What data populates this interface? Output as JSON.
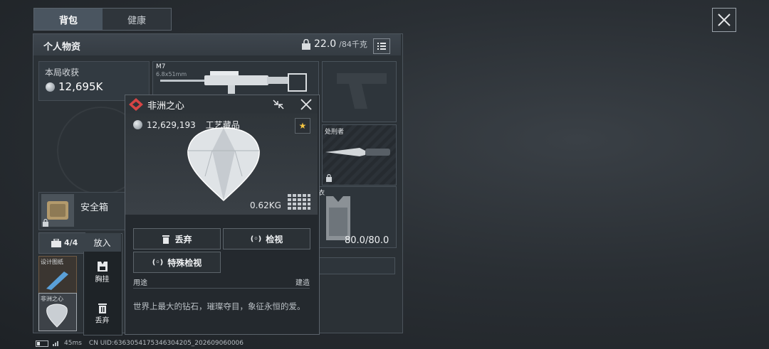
{
  "tabs": [
    {
      "label": "背包",
      "active": true
    },
    {
      "label": "健康",
      "active": false
    }
  ],
  "panel": {
    "title": "个人物资",
    "weight_current": "22.0",
    "weight_capacity": "/84千克"
  },
  "harvest": {
    "label": "本局收获",
    "value": "12,695K"
  },
  "equipment": {
    "weapon_name": "M7",
    "weapon_caliber": "6.8x51mm",
    "knife_name": "处刑者",
    "armor_label": "衣",
    "armor_durability": "80.0/80.0"
  },
  "safebox": {
    "label": "安全箱"
  },
  "backpack": {
    "capacity": "4/4",
    "item1_label": "设计图纸",
    "item2_label": "非洲之心"
  },
  "context_menu": {
    "place": "放入",
    "chest": "胸挂",
    "discard": "丢弃"
  },
  "popup": {
    "title": "非洲之心",
    "price": "12,629,193",
    "category": "工艺藏品",
    "weight": "0.62KG",
    "btn_discard": "丢弃",
    "btn_inspect": "检视",
    "btn_special": "特殊检视",
    "use_label": "用途",
    "build_label": "建造",
    "description": "世界上最大的钻石，璀璨夺目，象征永恒的爱。"
  },
  "footer": {
    "ping": "45ms",
    "uid": "CN UID:6363054175346304205_202609060006"
  },
  "colors": {
    "accent_star": "#f5c542",
    "rarity_red": "#d64545"
  }
}
